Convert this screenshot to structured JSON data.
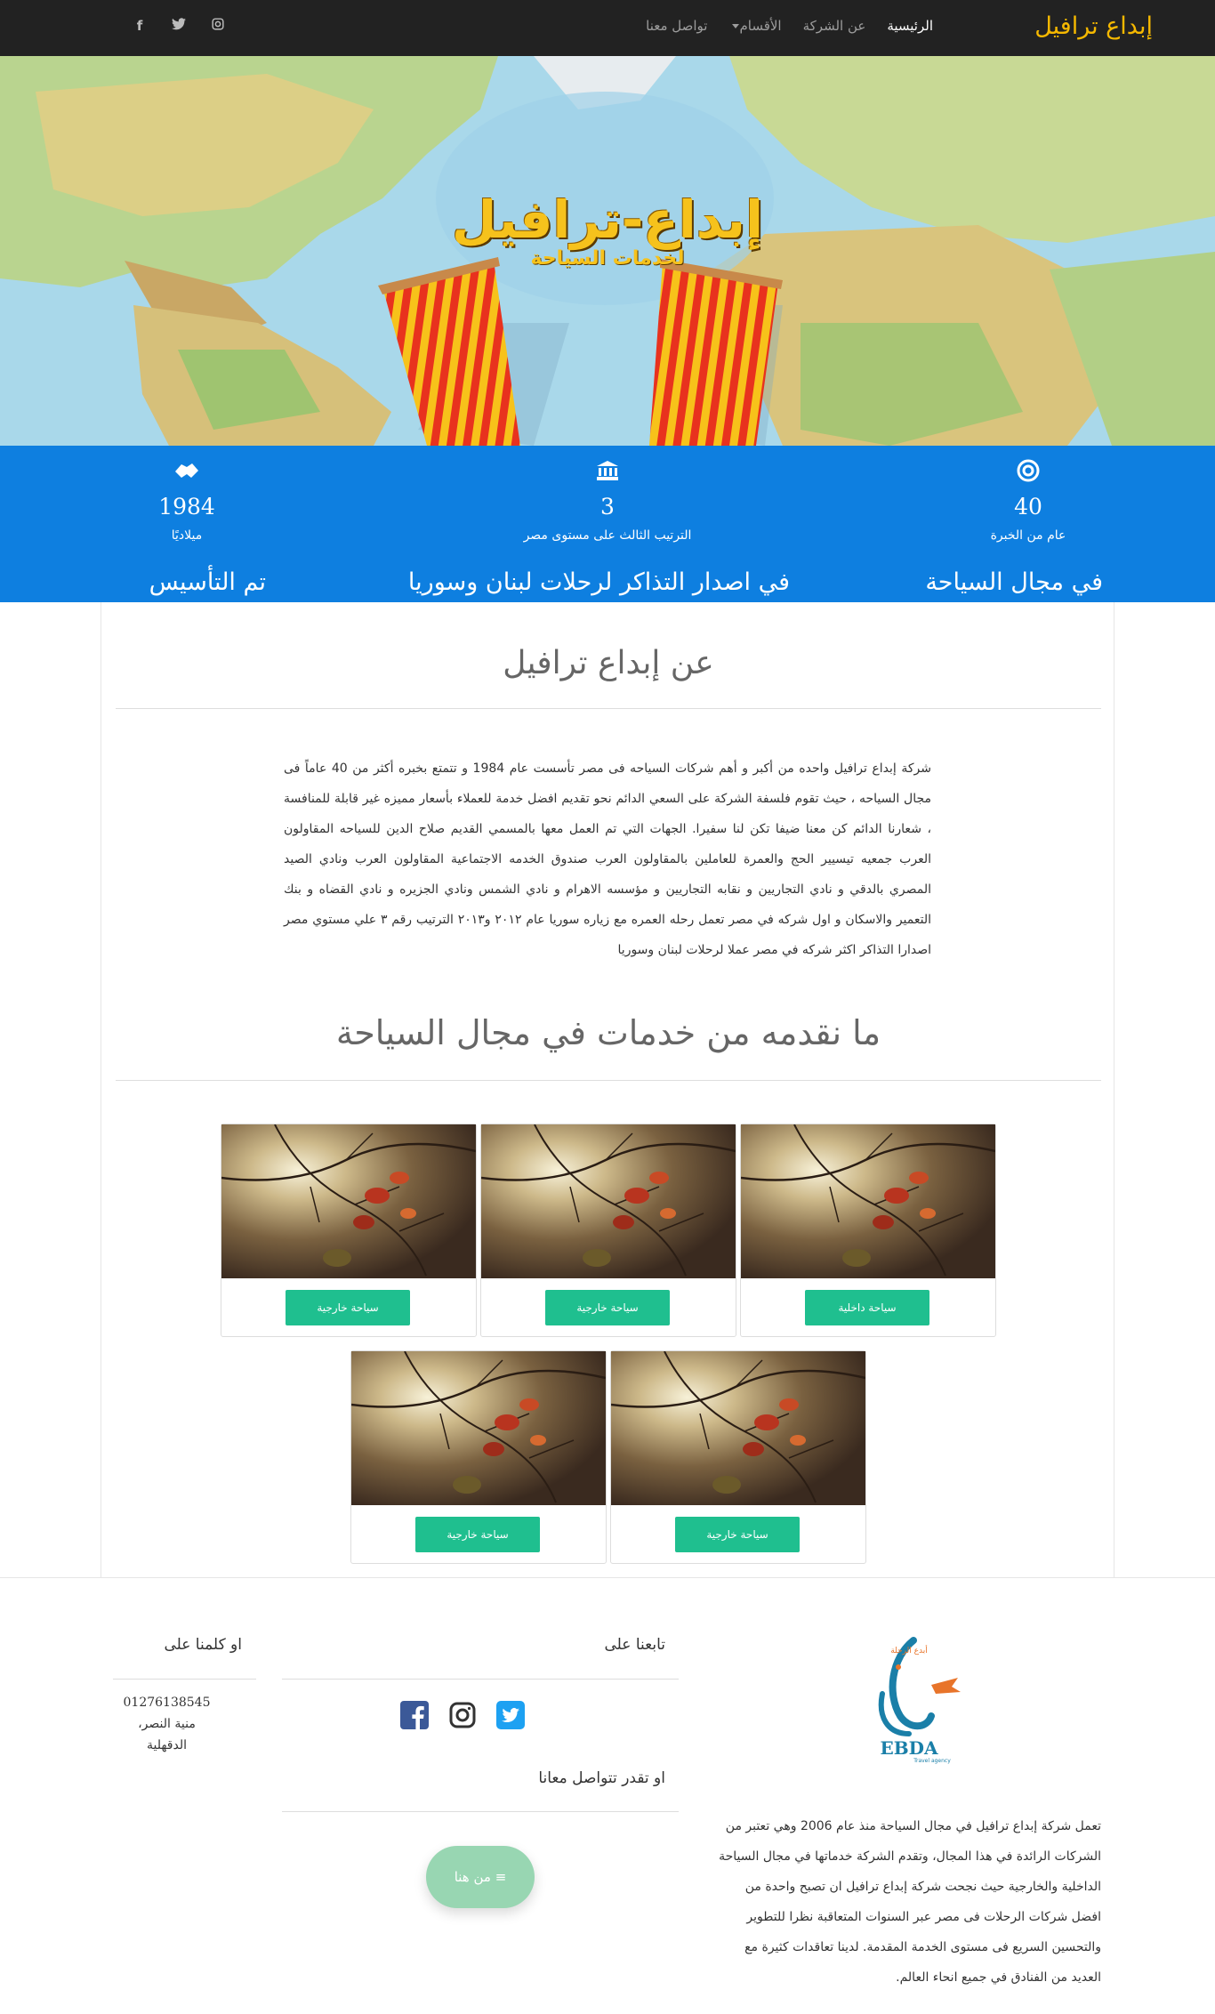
{
  "navbar": {
    "brand": "إبداع ترافيل",
    "links": [
      "الرئيسية",
      "عن الشركة",
      "الأقسام",
      "تواصل معنا"
    ],
    "social": [
      "facebook",
      "twitter",
      "instagram"
    ]
  },
  "hero": {
    "title": "إبداع-ترافيل",
    "subtitle": "لخدمات السياحة"
  },
  "stats": [
    {
      "icon": "target-icon",
      "number": "40",
      "label": "عام من الخبرة",
      "tag": "في مجال السياحة"
    },
    {
      "icon": "bank-icon",
      "number": "3",
      "label": "الترتيب الثالث على مستوى مصر",
      "tag": "في اصدار التذاكر لرحلات لبنان وسوريا"
    },
    {
      "icon": "handshake-icon",
      "number": "1984",
      "label": "ميلاديًا",
      "tag": "تم التأسيس"
    }
  ],
  "about": {
    "heading": "عن إبداع ترافيل",
    "text": "شركة إبداع ترافيل واحده من أكبر و أهم شركات السياحه فى مصر تأسست عام 1984 و تتمتع بخبره أكثر من 40 عاماً فى مجال السياحه ، حيث تقوم فلسفة الشركة على السعي الدائم نحو تقديم افضل خدمة للعملاء بأسعار مميزه غير قابلة للمنافسة ، شعارنا الدائم كن معنا ضيفا تكن لنا سفيرا.  الجهات التي تم العمل معها بالمسمي القديم صلاح الدين للسياحه المقاولون العرب جمعيه تيسيير الحج والعمرة للعاملين بالمقاولون العرب صندوق الخدمه الاجتماعية المقاولون العرب ونادي الصيد المصري بالدقي و نادي التجاريين و نقابه التجاريين و مؤسسه الاهرام و نادي الشمس ونادي الجزيره و نادي القضاه و بنك التعمير والاسكان و اول شركه في مصر تعمل رحله العمره مع زياره سوريا عام ٢٠١٢ و٢٠١٣ الترتيب رقم ٣ علي مستوي مصر اصدارا التذاكر اكثر شركه في مصر عملا لرحلات لبنان وسوريا"
  },
  "services": {
    "heading": "ما نقدمه من خدمات في مجال السياحة",
    "cards": [
      {
        "button": "سياحة داخلية"
      },
      {
        "button": "سياحة خارجية"
      },
      {
        "button": "سياحة خارجية"
      },
      {
        "button": "سياحة خارجية"
      },
      {
        "button": "سياحة خارجية"
      }
    ]
  },
  "footer": {
    "logo_text": "EBDA",
    "logo_arabic": "إبداع",
    "logo_small": "أبدع الرحلة",
    "logo_tag": "Travel agency",
    "description": "تعمل شركة إبداع ترافيل في مجال السياحة منذ عام 2006 وهي تعتبر من الشركات الرائدة في هذا المجال، وتقدم الشركة خدماتها في مجال السياحة الداخلية والخارجية حيث نجحت شركة إبداع ترافيل ان تصبح واحدة من افضل شركات الرحلات فى مصر عبر السنوات المتعاقبة نظرا للتطوير والتحسين السريع فى مستوى الخدمة المقدمة. لدينا تعاقدات كثيرة مع العديد من الفنادق في جميع انحاء العالم.",
    "follow_heading": "تابعنا على",
    "contact_heading": "او تقدر تتواصل معانا",
    "call_heading": "او كلمنا على",
    "phone": "01276138545",
    "city": "منية النصر،",
    "region": "الدقهلية",
    "cta": "من هنا",
    "colors": {
      "facebook": "#3b5998",
      "instagram": "#333333",
      "twitter": "#1da1f2"
    }
  }
}
